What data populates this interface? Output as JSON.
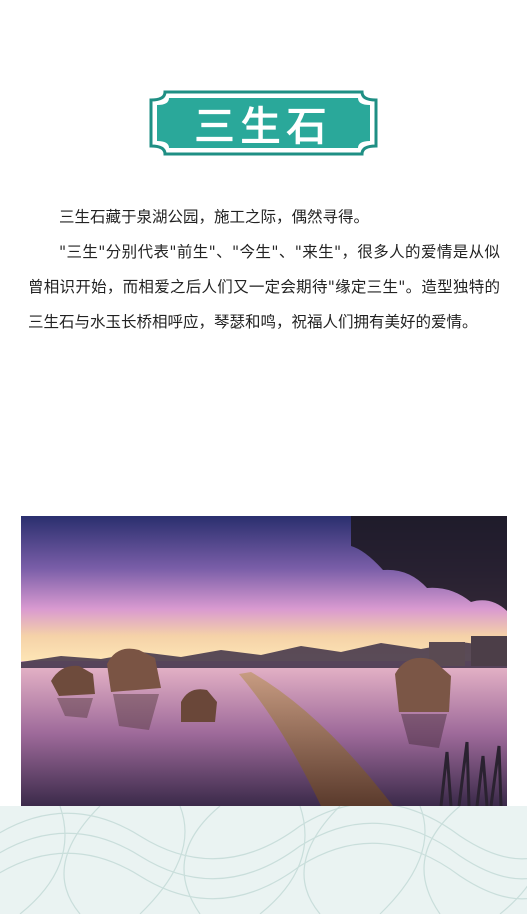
{
  "title": "三生石",
  "paragraphs": [
    "三生石藏于泉湖公园，施工之际，偶然寻得。",
    "\"三生\"分别代表\"前生\"、\"今生\"、\"来生\"，很多人的爱情是从似曾相识开始，而相爱之后人们又一定会期待\"缘定三生\"。造型独特的三生石与水玉长桥相呼应，琴瑟和鸣，祝福人们拥有美好的爱情。"
  ],
  "colors": {
    "badge_fill": "#2aa89a",
    "badge_border": "#1f8f84",
    "footer_bg": "#eaf3f2"
  }
}
